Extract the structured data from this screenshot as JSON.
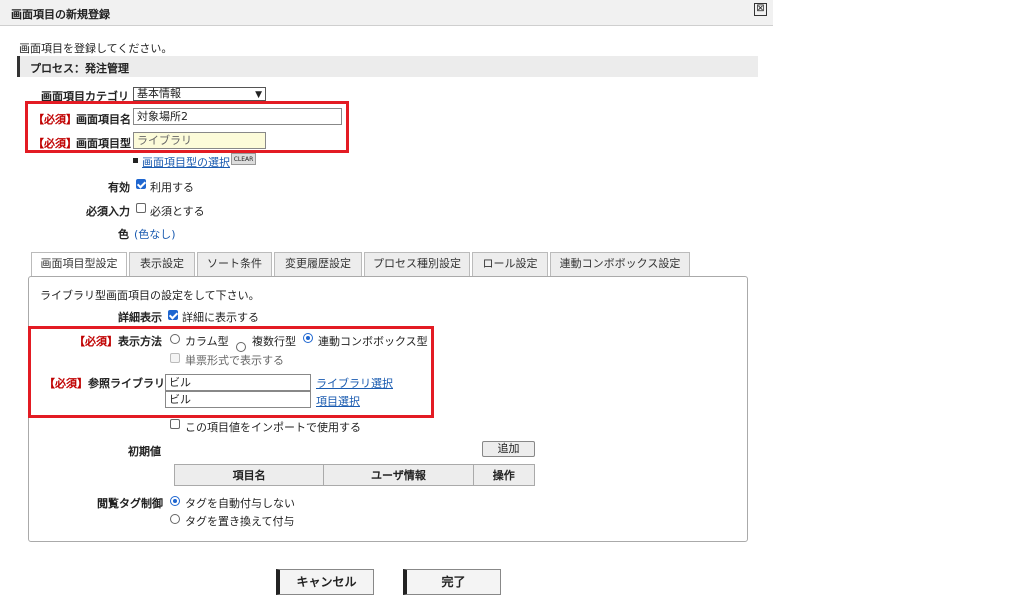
{
  "dialog": {
    "title": "画面項目の新規登録",
    "close_icon": "⊠"
  },
  "intro": "画面項目を登録してください。",
  "process": "プロセス：発注管理",
  "form": {
    "category_label": "画面項目カテゴリ",
    "category_value": "基本情報",
    "required_tag": "【必須】",
    "name_label": "画面項目名",
    "name_value": "対象場所2",
    "type_label": "画面項目型",
    "type_value": "ライブラリ",
    "type_select_link": "画面項目型の選択",
    "clear_label": "CLEAR",
    "enabled_label": "有効",
    "enabled_option": "利用する",
    "enabled_checked": true,
    "required_input_label": "必須入力",
    "required_input_option": "必須とする",
    "required_input_checked": false,
    "color_label": "色",
    "color_value": "(色なし)"
  },
  "tabs": [
    {
      "label": "画面項目型設定",
      "active": true
    },
    {
      "label": "表示設定",
      "active": false
    },
    {
      "label": "ソート条件",
      "active": false
    },
    {
      "label": "変更履歴設定",
      "active": false
    },
    {
      "label": "プロセス種別設定",
      "active": false
    },
    {
      "label": "ロール設定",
      "active": false
    },
    {
      "label": "連動コンボボックス設定",
      "active": false
    }
  ],
  "panel": {
    "description": "ライブラリ型画面項目の設定をして下さい。",
    "detail_label": "詳細表示",
    "detail_option": "詳細に表示する",
    "detail_checked": true,
    "required_tag": "【必須】",
    "display_method_label": "表示方法",
    "display_options": [
      {
        "label": "カラム型",
        "checked": false
      },
      {
        "label": "複数行型",
        "checked": false
      },
      {
        "label": "連動コンボボックス型",
        "checked": true
      }
    ],
    "single_form_option": "単票形式で表示する",
    "ref_library_label": "参照ライブラリ",
    "library_value": "ビル",
    "library_select_link": "ライブラリ選択",
    "item_value": "ビル",
    "item_select_link": "項目選択",
    "import_option": "この項目値をインポートで使用する",
    "initial_value_label": "初期値",
    "add_button": "追加",
    "table_headers": [
      "項目名",
      "ユーザ情報",
      "操作"
    ],
    "tag_control_label": "閲覧タグ制御",
    "tag_options": [
      {
        "label": "タグを自動付与しない",
        "checked": true
      },
      {
        "label": "タグを置き換えて付与",
        "checked": false
      }
    ]
  },
  "footer": {
    "cancel_label": "キャンセル",
    "done_label": "完了"
  },
  "colors": {
    "highlight_border": "#e31b23",
    "required_text": "#c00000",
    "link": "#1a5bb0"
  }
}
